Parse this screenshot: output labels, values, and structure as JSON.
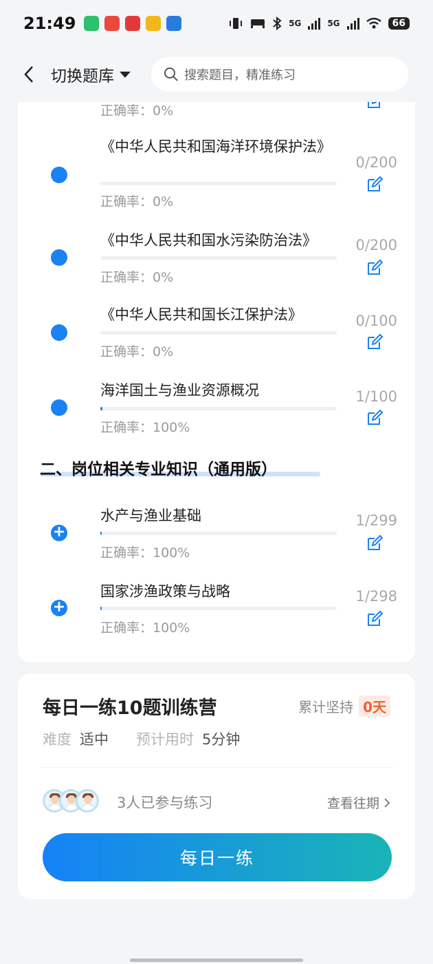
{
  "status_bar": {
    "time": "21:49",
    "battery": "66",
    "signal_labels": [
      "5G",
      "5G"
    ],
    "app_icon_colors": [
      "#2cc06a",
      "#e84a3c",
      "#e23a3a",
      "#f2b81b",
      "#2a7be0"
    ]
  },
  "header": {
    "title": "切换题库",
    "search_placeholder": "搜索题目，精准练习"
  },
  "accent_color": "#1a82f2",
  "section1_partial": {
    "accuracy": "正确率：0%"
  },
  "section1_items": [
    {
      "name": "《中华人民共和国海洋环境保护法》",
      "count": "0/200",
      "accuracy": "正确率：0%",
      "progress": 0
    },
    {
      "name": "《中华人民共和国水污染防治法》",
      "count": "0/200",
      "accuracy": "正确率：0%",
      "progress": 0
    },
    {
      "name": "《中华人民共和国长江保护法》",
      "count": "0/100",
      "accuracy": "正确率：0%",
      "progress": 0
    },
    {
      "name": "海洋国土与渔业资源概况",
      "count": "1/100",
      "accuracy": "正确率：100%",
      "progress": 0.01
    }
  ],
  "section2": {
    "title": "二、岗位相关专业知识（通用版）",
    "items": [
      {
        "name": "水产与渔业基础",
        "count": "1/299",
        "accuracy": "正确率：100%",
        "progress": 0.003
      },
      {
        "name": "国家涉渔政策与战略",
        "count": "1/298",
        "accuracy": "正确率：100%",
        "progress": 0.003
      }
    ]
  },
  "camp": {
    "title": "每日一练10题训练营",
    "persist_label": "累计坚持",
    "persist_days": "0天",
    "difficulty_label": "难度",
    "difficulty_value": "适中",
    "time_label": "预计用时",
    "time_value": "5分钟",
    "joined_text": "3人已参与练习",
    "history_label": "查看往期",
    "cta_label": "每日一练"
  }
}
